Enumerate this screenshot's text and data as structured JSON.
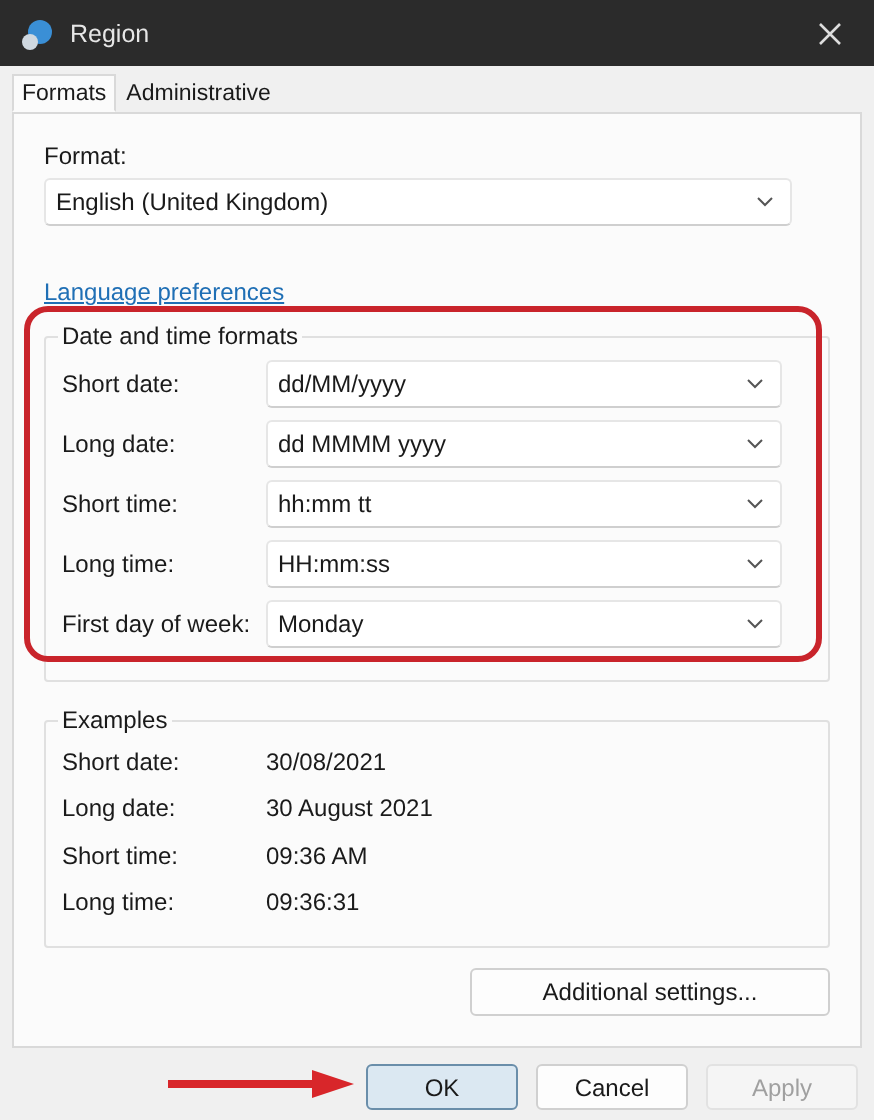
{
  "window": {
    "title": "Region"
  },
  "tabs": [
    {
      "label": "Formats",
      "selected": true
    },
    {
      "label": "Administrative",
      "selected": false
    }
  ],
  "format": {
    "label": "Format:",
    "value": "English (United Kingdom)"
  },
  "language_link": "Language preferences",
  "date_time_formats": {
    "title": "Date and time formats",
    "rows": [
      {
        "label": "Short date:",
        "value": "dd/MM/yyyy"
      },
      {
        "label": "Long date:",
        "value": "dd MMMM yyyy"
      },
      {
        "label": "Short time:",
        "value": "hh:mm tt"
      },
      {
        "label": "Long time:",
        "value": "HH:mm:ss"
      },
      {
        "label": "First day of week:",
        "value": "Monday"
      }
    ]
  },
  "examples": {
    "title": "Examples",
    "rows": [
      {
        "label": "Short date:",
        "value": "30/08/2021"
      },
      {
        "label": "Long date:",
        "value": "30 August 2021"
      },
      {
        "label": "Short time:",
        "value": "09:36 AM"
      },
      {
        "label": "Long time:",
        "value": "09:36:31"
      }
    ]
  },
  "additional_button": "Additional settings...",
  "buttons": [
    {
      "label": "OK",
      "kind": "default",
      "disabled": false
    },
    {
      "label": "Cancel",
      "kind": "normal",
      "disabled": false
    },
    {
      "label": "Apply",
      "kind": "normal",
      "disabled": true
    }
  ]
}
